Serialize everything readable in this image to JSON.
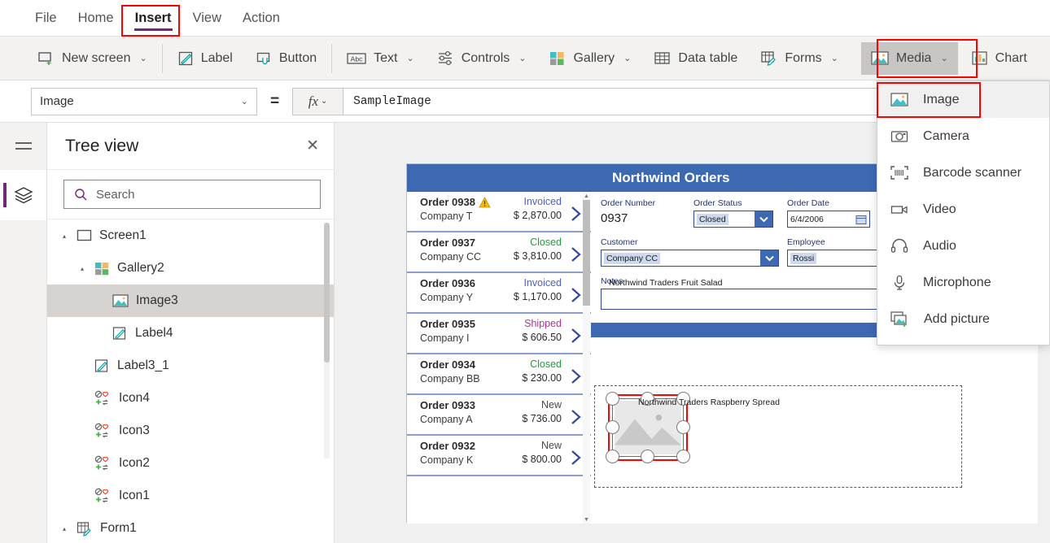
{
  "menubar": {
    "items": [
      {
        "label": "File",
        "active": false
      },
      {
        "label": "Home",
        "active": false
      },
      {
        "label": "Insert",
        "active": true
      },
      {
        "label": "View",
        "active": false
      },
      {
        "label": "Action",
        "active": false
      }
    ]
  },
  "ribbon": {
    "new_screen": "New screen",
    "label": "Label",
    "button": "Button",
    "text": "Text",
    "controls": "Controls",
    "gallery": "Gallery",
    "data_table": "Data table",
    "forms": "Forms",
    "media": "Media",
    "chart": "Chart",
    "chevron": "⌄"
  },
  "formula_bar": {
    "property": "Image",
    "equals": "=",
    "fx": "fx",
    "chevron": "⌄",
    "formula": "SampleImage"
  },
  "tree_view": {
    "title": "Tree view",
    "close": "✕",
    "search_placeholder": "Search",
    "items": [
      {
        "label": "Screen1",
        "indent": 0,
        "icon": "screen-icon",
        "twisty": "▴",
        "selected": false
      },
      {
        "label": "Gallery2",
        "indent": 1,
        "icon": "gallery-icon",
        "twisty": "▴",
        "selected": false
      },
      {
        "label": "Image3",
        "indent": 2,
        "icon": "image-icon",
        "twisty": "",
        "selected": true
      },
      {
        "label": "Label4",
        "indent": 2,
        "icon": "label-icon",
        "twisty": "",
        "selected": false
      },
      {
        "label": "Label3_1",
        "indent": 1,
        "icon": "label-icon",
        "twisty": "",
        "selected": false
      },
      {
        "label": "Icon4",
        "indent": 1,
        "icon": "icons-icon",
        "twisty": "",
        "selected": false
      },
      {
        "label": "Icon3",
        "indent": 1,
        "icon": "icons-icon",
        "twisty": "",
        "selected": false
      },
      {
        "label": "Icon2",
        "indent": 1,
        "icon": "icons-icon",
        "twisty": "",
        "selected": false
      },
      {
        "label": "Icon1",
        "indent": 1,
        "icon": "icons-icon",
        "twisty": "",
        "selected": false
      },
      {
        "label": "Form1",
        "indent": 0,
        "icon": "form-icon",
        "twisty": "▴",
        "selected": false
      }
    ]
  },
  "media_menu": {
    "items": [
      {
        "label": "Image",
        "icon": "image-icon",
        "highlighted": true
      },
      {
        "label": "Camera",
        "icon": "camera-icon",
        "highlighted": false
      },
      {
        "label": "Barcode scanner",
        "icon": "barcode-icon",
        "highlighted": false
      },
      {
        "label": "Video",
        "icon": "video-icon",
        "highlighted": false
      },
      {
        "label": "Audio",
        "icon": "audio-icon",
        "highlighted": false
      },
      {
        "label": "Microphone",
        "icon": "mic-icon",
        "highlighted": false
      },
      {
        "label": "Add picture",
        "icon": "addpic-icon",
        "highlighted": false
      }
    ]
  },
  "app": {
    "gallery": {
      "rows": [
        {
          "order": "Order 0938",
          "company": "Company T",
          "status": "Invoiced",
          "status_color": "#4a5fd0",
          "amount": "$ 2,870.00",
          "warning": true
        },
        {
          "order": "Order 0937",
          "company": "Company CC",
          "status": "Closed",
          "status_color": "#1f9d3c",
          "amount": "$ 3,810.00",
          "warning": false
        },
        {
          "order": "Order 0936",
          "company": "Company Y",
          "status": "Invoiced",
          "status_color": "#4a5fd0",
          "amount": "$ 1,170.00",
          "warning": false
        },
        {
          "order": "Order 0935",
          "company": "Company I",
          "status": "Shipped",
          "status_color": "#b4329b",
          "amount": "$ 606.50",
          "warning": false
        },
        {
          "order": "Order 0934",
          "company": "Company BB",
          "status": "Closed",
          "status_color": "#1f9d3c",
          "amount": "$ 230.00",
          "warning": false
        },
        {
          "order": "Order 0933",
          "company": "Company A",
          "status": "New",
          "status_color": "#4a4a4a",
          "amount": "$ 736.00",
          "warning": false
        },
        {
          "order": "Order 0932",
          "company": "Company K",
          "status": "New",
          "status_color": "#4a4a4a",
          "amount": "$ 800.00",
          "warning": false
        }
      ]
    },
    "form": {
      "title": "Northwind Orders",
      "delete_icon": "trash-icon",
      "fields": {
        "order_number_label": "Order Number",
        "order_number_value": "0937",
        "order_status_label": "Order Status",
        "order_status_value": "Closed",
        "order_date_label": "Order Date",
        "order_date_value": "6/4/2006",
        "customer_label": "Customer",
        "customer_value": "Company CC",
        "employee_label": "Employee",
        "employee_value": "Rossi",
        "notes_label": "Notes",
        "notes_value": ""
      }
    },
    "detail": {
      "item1_caption": "Northwind Traders Raspberry Spread",
      "item2_caption": "Northwind Traders Fruit Salad"
    }
  },
  "colors": {
    "accent_purple": "#742774",
    "highlight_red": "#ff0000",
    "app_blue": "#3d69b3",
    "selected_gray": "#d6d3d1"
  }
}
